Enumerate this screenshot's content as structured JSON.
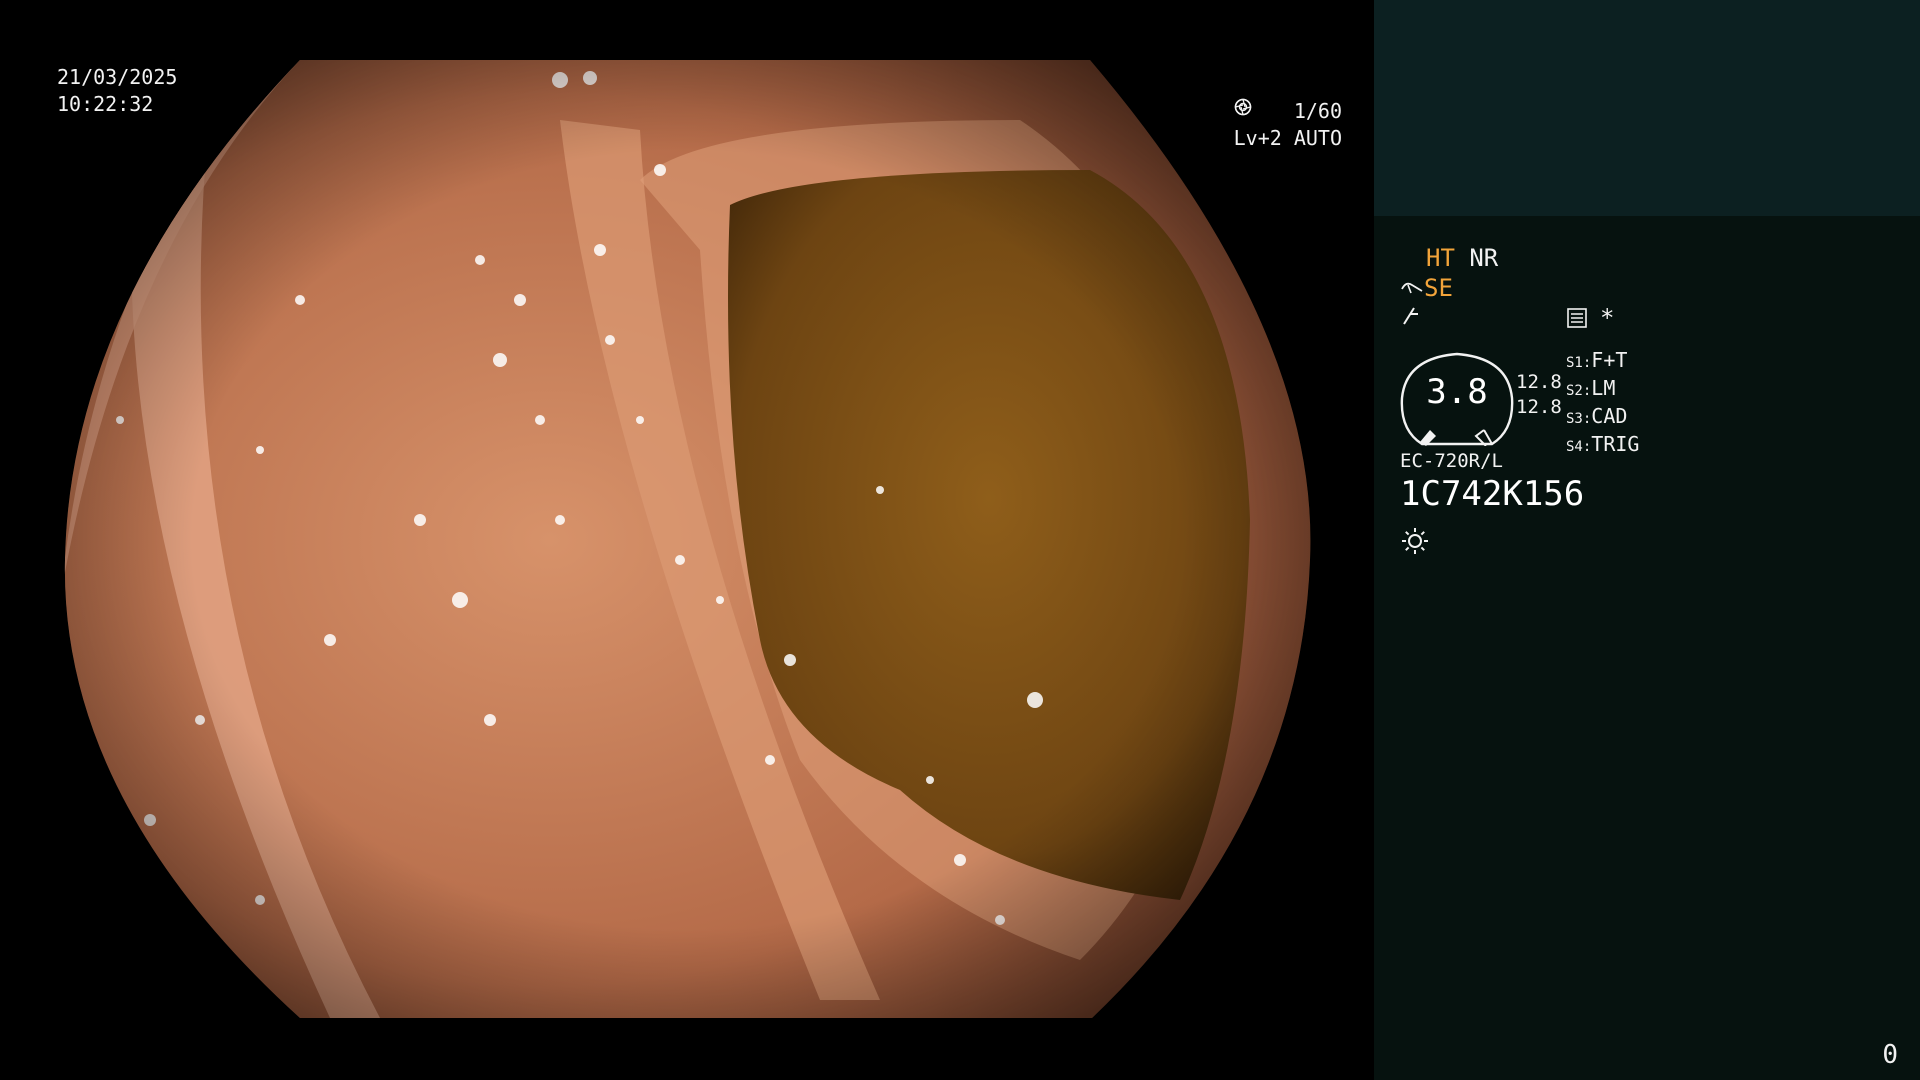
{
  "datetime": {
    "date": "21/03/2025",
    "time": "10:22:32"
  },
  "exposure": {
    "shutter": "1/60",
    "level": "Lv+2 AUTO"
  },
  "panel": {
    "ht": "HT",
    "nr": "NR",
    "se": "SE",
    "asterisk": "*",
    "gauge_value": "3.8",
    "gauge_left": "12.8",
    "gauge_right": "12.8",
    "modes": [
      {
        "slot": "S1:",
        "label": "F+T"
      },
      {
        "slot": "S2:",
        "label": "LM"
      },
      {
        "slot": "S3:",
        "label": "CAD"
      },
      {
        "slot": "S4:",
        "label": "TRIG"
      }
    ],
    "scope_model": "EC-720R/L",
    "serial": "1C742K156",
    "counter": "0"
  },
  "colors": {
    "panel_top": "#0c2021",
    "panel": "#06120f",
    "accent": "#f2a43a",
    "text": "#f2f2f2"
  },
  "icons": [
    "shutter-icon",
    "iris-icon",
    "scope-tip-icon",
    "flash-icon",
    "menu-list-icon",
    "sun-icon"
  ]
}
